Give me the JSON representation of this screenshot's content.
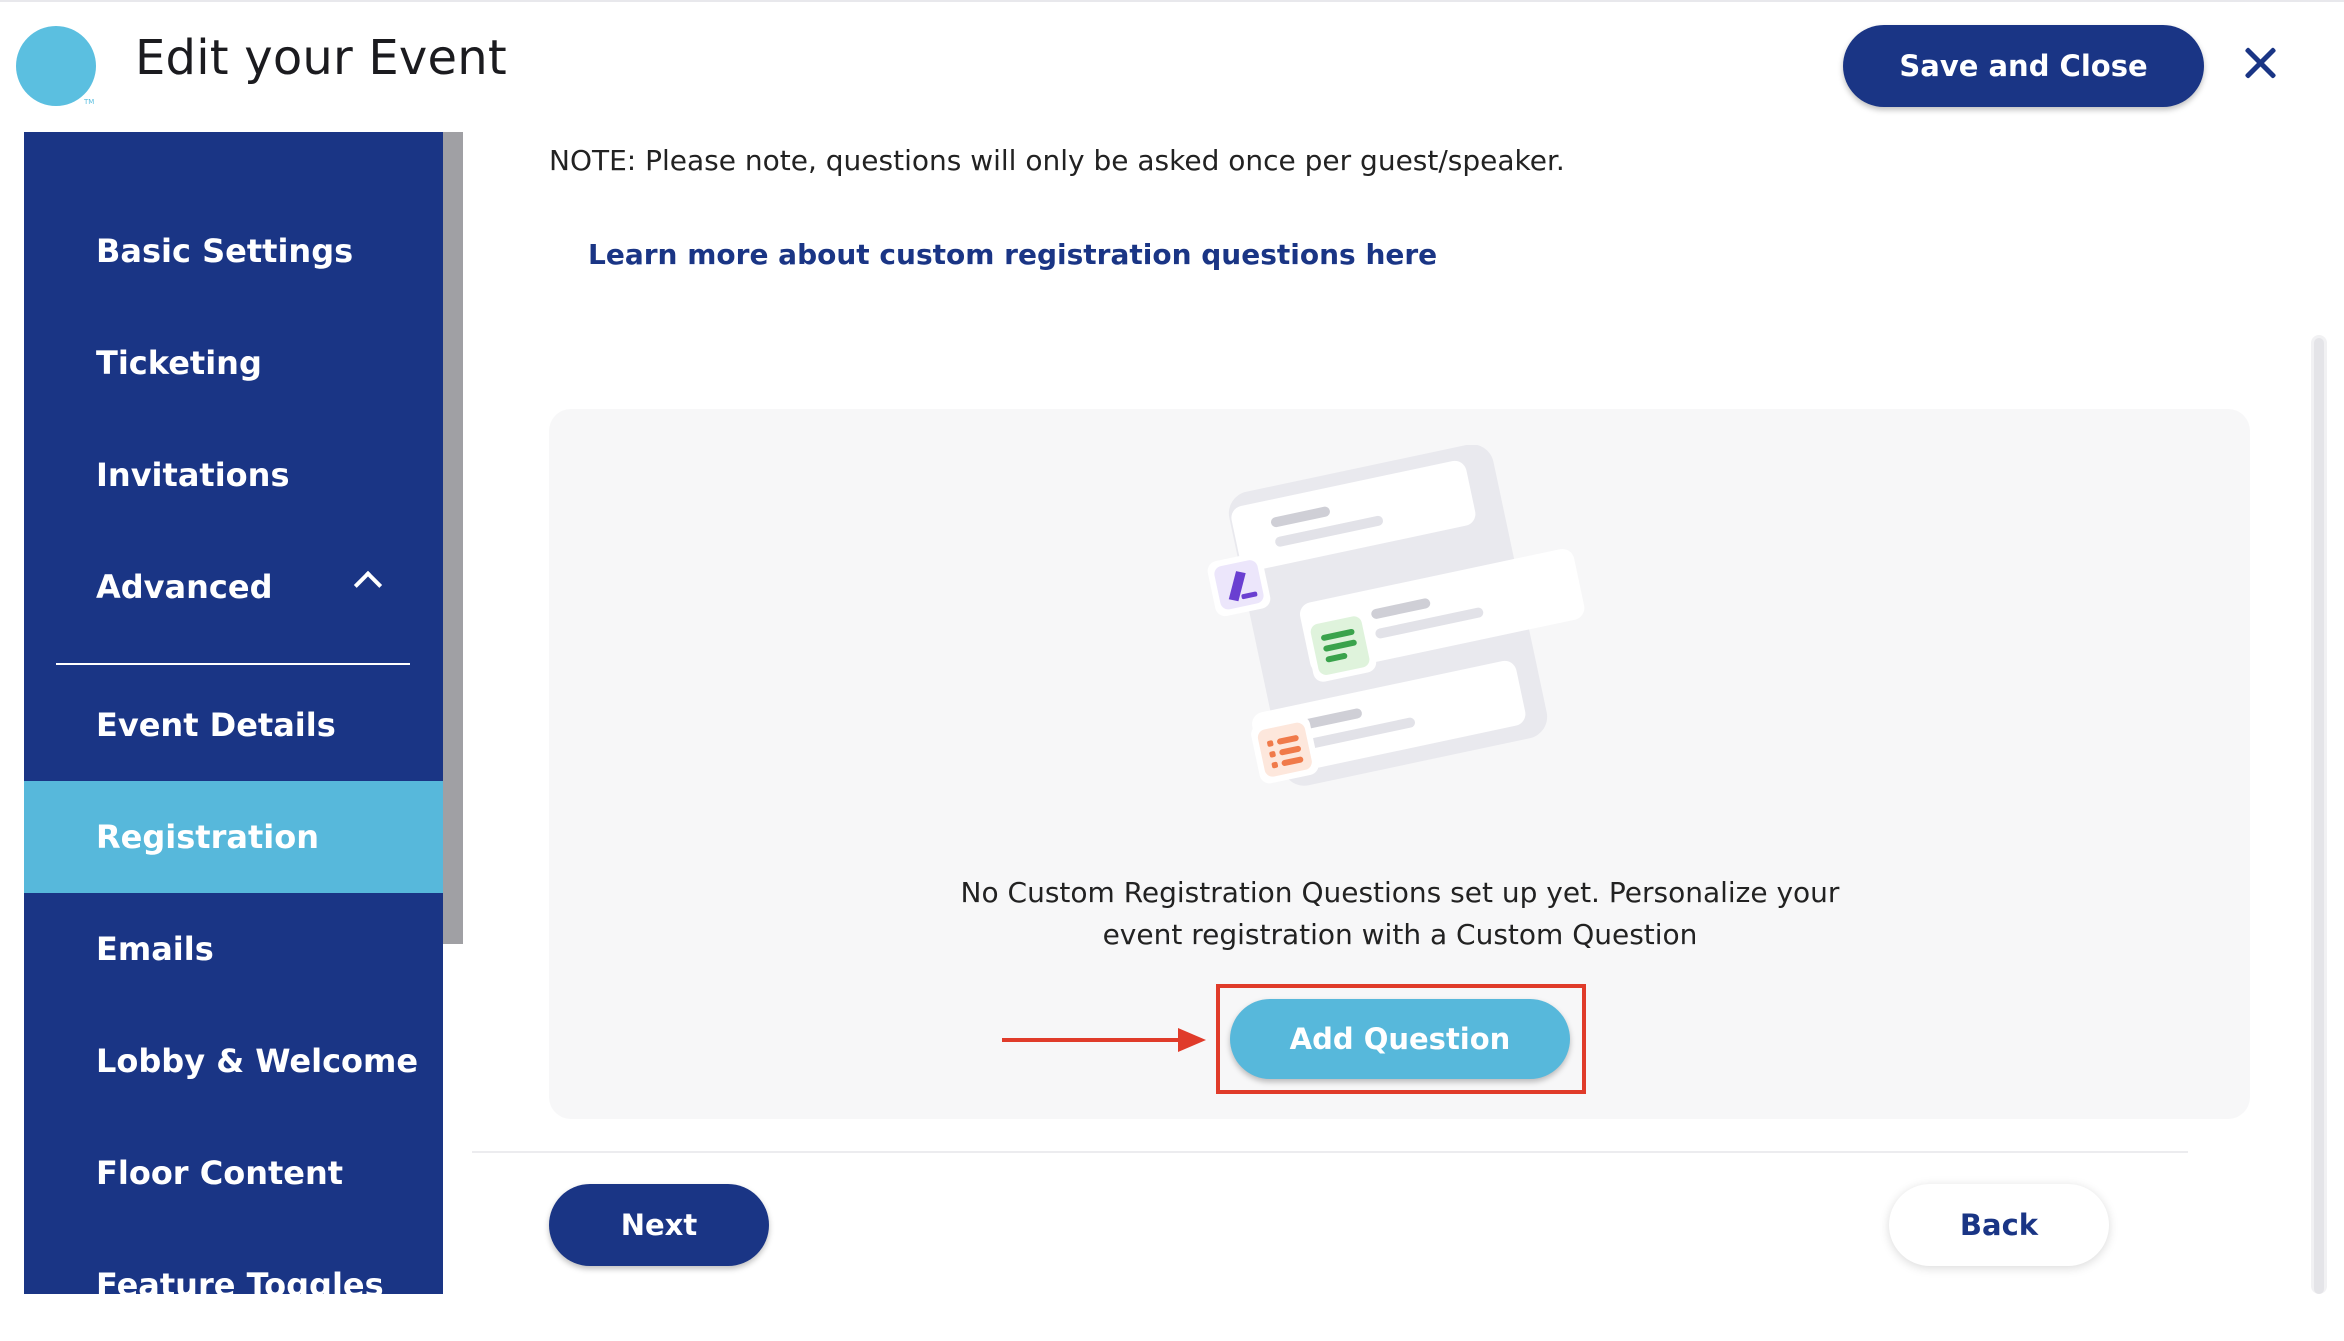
{
  "header": {
    "title": "Edit your Event",
    "logo_mark": "TM",
    "save_label": "Save and Close",
    "close_icon": "close-icon"
  },
  "sidebar": {
    "items": [
      {
        "label": "Basic Settings"
      },
      {
        "label": "Ticketing"
      },
      {
        "label": "Invitations"
      },
      {
        "label": "Advanced",
        "expanded": true
      },
      {
        "label": "Event Details"
      },
      {
        "label": "Registration",
        "active": true
      },
      {
        "label": "Emails"
      },
      {
        "label": "Lobby & Welcome"
      },
      {
        "label": "Floor Content"
      },
      {
        "label": "Feature Toggles"
      }
    ]
  },
  "main": {
    "note": "NOTE: Please note, questions will only be asked once per guest/speaker.",
    "learn_link": "Learn more about custom registration questions here",
    "empty_state": {
      "line1": "No Custom Registration Questions set up yet. Personalize your",
      "line2": "event registration with a Custom Question",
      "add_label": "Add Question"
    }
  },
  "footer": {
    "next_label": "Next",
    "back_label": "Back"
  },
  "colors": {
    "primary_navy": "#1a3585",
    "accent_blue": "#57b8db",
    "highlight_red": "#e03b2a"
  }
}
